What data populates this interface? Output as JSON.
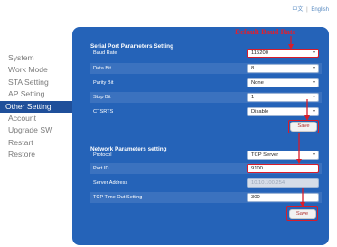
{
  "language": {
    "chinese": "中文",
    "separator": "|",
    "english": "English"
  },
  "sidebar": {
    "items": [
      {
        "label": "System",
        "active": false
      },
      {
        "label": "Work Mode",
        "active": false
      },
      {
        "label": "STA Setting",
        "active": false
      },
      {
        "label": "AP Setting",
        "active": false
      },
      {
        "label": "Other Setting",
        "active": true
      },
      {
        "label": "Account",
        "active": false
      },
      {
        "label": "Upgrade SW",
        "active": false
      },
      {
        "label": "Restart",
        "active": false
      },
      {
        "label": "Restore",
        "active": false
      }
    ]
  },
  "annotation": {
    "text": "Default Baud Rate",
    "color": "#e02030"
  },
  "serial": {
    "title": "Serial Port Parameters Setting",
    "baud_rate": {
      "label": "Baud Rate",
      "value": "115200"
    },
    "data_bit": {
      "label": "Data Bit",
      "value": "8"
    },
    "parity_bit": {
      "label": "Parity Bit",
      "value": "None"
    },
    "stop_bit": {
      "label": "Stop Bit",
      "value": "1"
    },
    "cts_rts": {
      "label": "CTSRTS",
      "value": "Disable"
    },
    "save_label": "Save"
  },
  "network": {
    "title": "Network Parameters setting",
    "protocol": {
      "label": "Protocol",
      "value": "TCP Server"
    },
    "port_id": {
      "label": "Port ID",
      "value": "9100"
    },
    "server_address": {
      "label": "Server Address",
      "value": "10.10.100.254"
    },
    "timeout": {
      "label": "TCP Time Out Setting",
      "value": "300"
    },
    "save_label": "Save"
  },
  "colors": {
    "panel": "#2563b8",
    "active_nav": "#1f4f9a",
    "highlight": "#d81c2a"
  }
}
